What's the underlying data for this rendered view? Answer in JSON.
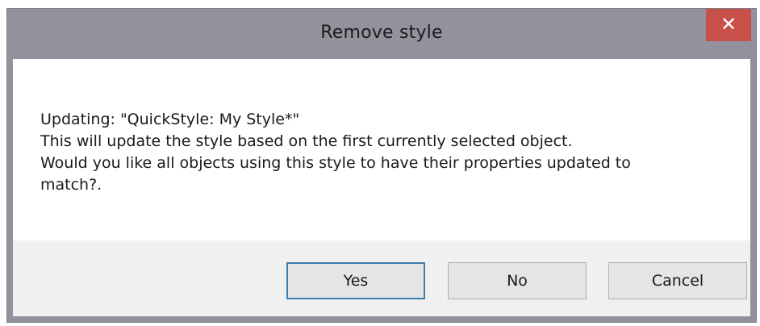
{
  "dialog": {
    "title": "Remove style",
    "close_glyph": "✕",
    "message_lines": [
      "Updating: \"QuickStyle: My Style*\"",
      "This will update the style based on the first currently selected object.",
      "Would you like all objects using this style to have their properties updated to",
      "match?."
    ],
    "buttons": {
      "yes": "Yes",
      "no": "No",
      "cancel": "Cancel"
    }
  },
  "colors": {
    "frame": "#93919b",
    "close_button": "#c7504a",
    "button_area": "#f0f0f0",
    "default_button_border": "#3c7fb1"
  },
  "icons": {
    "close": "close-icon"
  }
}
